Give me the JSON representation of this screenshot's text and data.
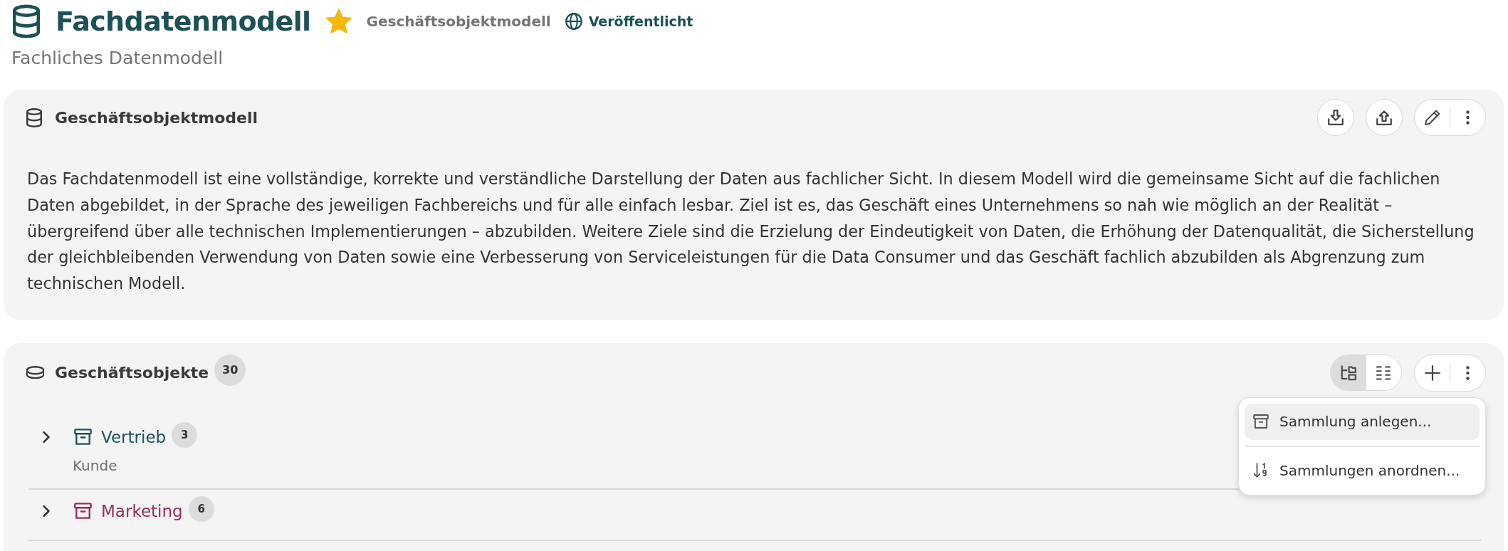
{
  "header": {
    "title": "Fachdatenmodell",
    "favorite": true,
    "type": "Geschäftsobjektmodell",
    "status": "Veröffentlicht",
    "subtitle": "Fachliches Datenmodell"
  },
  "model": {
    "title": "Geschäftsobjektmodell",
    "description": "Das Fachdatenmodell ist eine vollständige, korrekte und verständliche Darstellung der Daten aus fachlicher Sicht. In diesem Modell wird die gemeinsame Sicht auf die fachlichen Daten abgebildet, in der Sprache des jeweiligen Fachbereichs und für alle einfach lesbar. Ziel ist es, das Geschäft eines Unternehmens so nah wie möglich an der Realität – übergreifend über alle technischen Implementierungen – abzubilden. Weitere Ziele sind die Erzielung der Eindeutigkeit von Daten, die Erhöhung der Datenqualität, die Sicherstellung der gleichbleibenden Verwendung von Daten sowie eine Verbesserung von Serviceleistungen für die Data Consumer und das Geschäft fachlich abzubilden als Abgrenzung zum technischen Modell."
  },
  "objects": {
    "title": "Geschäftsobjekte",
    "count": "30",
    "views": [
      {
        "kind": "tree",
        "selected": true
      },
      {
        "kind": "list",
        "selected": false
      }
    ],
    "collections": [
      {
        "name": "Vertrieb",
        "count": "3",
        "color": "#1d5458",
        "expanded": false,
        "subtitle": "Kunde"
      },
      {
        "name": "Marketing",
        "count": "6",
        "color": "#9a2c64",
        "expanded": false
      }
    ]
  },
  "menu": {
    "items": [
      {
        "kind": "create",
        "label": "Sammlung anlegen...",
        "highlighted": true
      },
      {
        "kind": "sort",
        "label": "Sammlungen anordnen...",
        "highlighted": false
      }
    ]
  }
}
